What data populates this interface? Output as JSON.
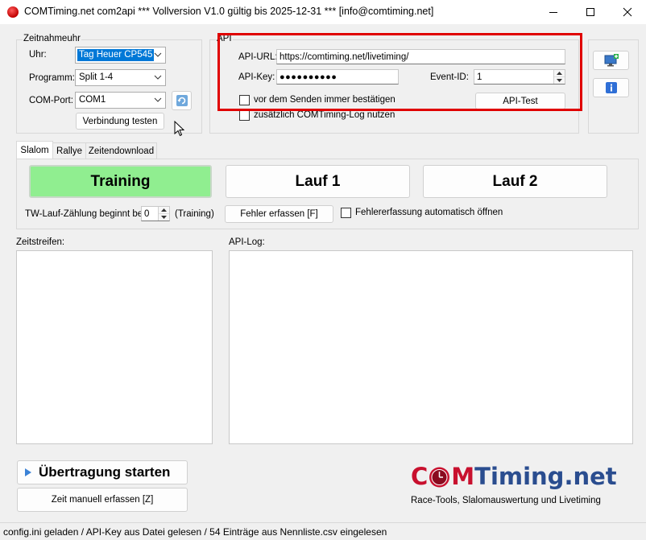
{
  "window": {
    "title": "COMTiming.net com2api *** Vollversion V1.0 gültig bis 2025-12-31 *** [info@comtiming.net]"
  },
  "zeitnahmeuhr": {
    "group_label": "Zeitnahmeuhr",
    "uhr_label": "Uhr:",
    "uhr_value": "Tag Heuer CP545",
    "programm_label": "Programm:",
    "programm_value": "Split 1-4",
    "comport_label": "COM-Port:",
    "comport_value": "COM1",
    "test_button": "Verbindung testen"
  },
  "api": {
    "group_label": "API",
    "url_label": "API-URL:",
    "url_value": "https://comtiming.net/livetiming/",
    "key_label": "API-Key:",
    "key_value": "●●●●●●●●●●",
    "event_label": "Event-ID:",
    "event_value": "1",
    "confirm_checkbox_label": "vor dem Senden immer bestätigen",
    "log_checkbox_label": "zusätzlich COMTiming-Log nutzen",
    "test_button": "API-Test"
  },
  "tabs": [
    {
      "label": "Slalom",
      "active": true
    },
    {
      "label": "Rallye",
      "active": false
    },
    {
      "label": "Zeitendownload",
      "active": false
    }
  ],
  "slalom": {
    "training_button": "Training",
    "lauf1_button": "Lauf 1",
    "lauf2_button": "Lauf 2",
    "tw_label": "TW-Lauf-Zählung beginnt bei:",
    "tw_value": "0",
    "tw_suffix": "(Training)",
    "fehler_button": "Fehler erfassen [F]",
    "fehler_auto_label": "Fehlererfassung automatisch öffnen",
    "active_color": "#90ee90"
  },
  "zeitstreifen": {
    "label": "Zeitstreifen:"
  },
  "api_log": {
    "label": "API-Log:"
  },
  "actions": {
    "start_button": "Übertragung starten",
    "manual_button": "Zeit manuell erfassen [Z]"
  },
  "logo": {
    "part_c": "C",
    "part_m": "M",
    "part_rest": "Timing.net",
    "tagline": "Race-Tools, Slalomauswertung und Livetiming",
    "red": "#c8102e",
    "blue": "#2a4d8f"
  },
  "status": {
    "text": "config.ini geladen / API-Key aus Datei gelesen / 54 Einträge aus Nennliste.csv eingelesen"
  },
  "icons": {
    "side_top": "monitor-add-icon",
    "side_bottom": "info-icon",
    "refresh": "refresh-icon"
  },
  "highlight": {
    "color": "#e00000"
  }
}
